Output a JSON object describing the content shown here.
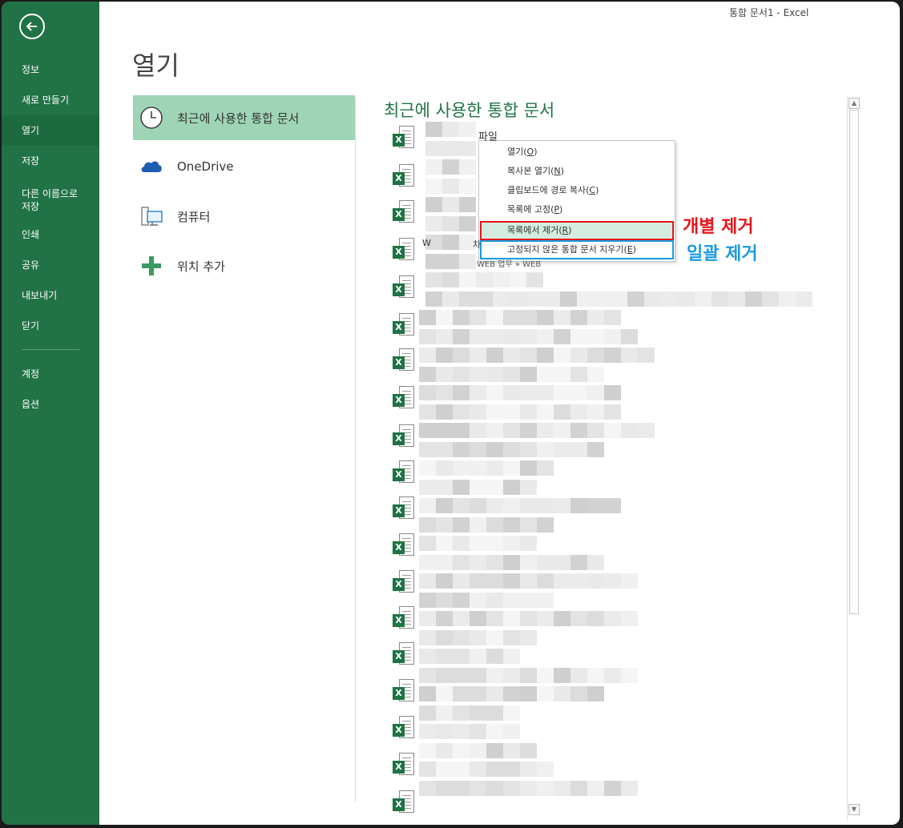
{
  "window": {
    "title": "통합 문서1 - Excel"
  },
  "sidebar": {
    "back_label": "back",
    "items": [
      {
        "label": "정보"
      },
      {
        "label": "새로 만들기"
      },
      {
        "label": "열기"
      },
      {
        "label": "저장"
      },
      {
        "label": "다른 이름으로\n저장"
      },
      {
        "label": "인쇄"
      },
      {
        "label": "공유"
      },
      {
        "label": "내보내기"
      },
      {
        "label": "닫기"
      },
      {
        "label": "계정"
      },
      {
        "label": "옵션"
      }
    ],
    "active_index": 2
  },
  "page": {
    "title": "열기"
  },
  "locations": [
    {
      "label": "최근에 사용한 통합 문서",
      "icon": "clock-icon"
    },
    {
      "label": "OneDrive",
      "icon": "cloud-icon"
    },
    {
      "label": "컴퓨터",
      "icon": "computer-icon"
    },
    {
      "label": "위치 추가",
      "icon": "plus-icon"
    }
  ],
  "recent": {
    "title": "최근에 사용한 통합 문서",
    "first_file_suffix": "파일",
    "path_fragment": "WEB 업무 » WEB",
    "row_char": "W",
    "row_char2": "차"
  },
  "context_menu": {
    "items": [
      {
        "label": "열기",
        "key": "O"
      },
      {
        "label": "복사본 열기",
        "key": "N"
      },
      {
        "label": "클립보드에 경로 복사",
        "key": "C"
      },
      {
        "label": "목록에 고정",
        "key": "P"
      },
      {
        "label": "목록에서 제거",
        "key": "R"
      },
      {
        "label": "고정되지 않은 통합 문서 지우기",
        "key": "E"
      }
    ],
    "highlighted_index": 4
  },
  "annotations": {
    "red": "개별 제거",
    "blue": "일괄 제거",
    "red_color": "#e8151a",
    "blue_color": "#1b9ae0"
  },
  "colors": {
    "sidebar": "#217346",
    "accent": "#217346",
    "selected_location": "#9fd5b7"
  }
}
